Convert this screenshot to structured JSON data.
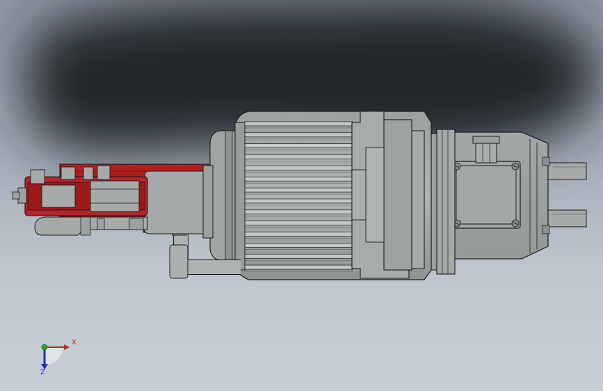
{
  "scene": {
    "subject": "electro-hydraulic-thruster-cad-model",
    "colors": {
      "background_top": "#8e97a3",
      "background_bottom": "#c9cfd6",
      "shadow": "#22252b",
      "motor_gray": "#a4a9a8",
      "motor_dark": "#5e6463",
      "accent_red": "#a51c1c",
      "outline": "#1a1a1a"
    }
  },
  "triad": {
    "x_label": "X",
    "z_label": "Z",
    "x_color": "#c81e1e",
    "y_color": "#2aa52a",
    "z_color": "#1e2fb0"
  }
}
